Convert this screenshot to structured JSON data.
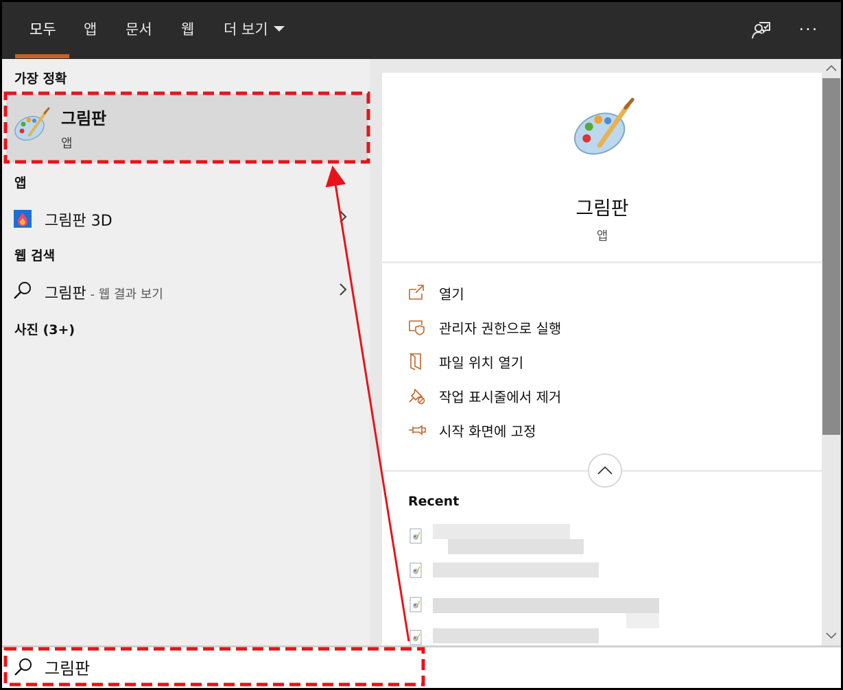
{
  "topbar": {
    "tabs": [
      {
        "label": "모두",
        "active": true
      },
      {
        "label": "앱"
      },
      {
        "label": "문서"
      },
      {
        "label": "웹"
      },
      {
        "label": "더 보기"
      }
    ],
    "feedback_icon": "feedback-icon",
    "options_label": "···"
  },
  "left": {
    "best_match_heading": "가장 정확",
    "best_match": {
      "title": "그림판",
      "subtitle": "앱",
      "icon": "paint-palette-icon"
    },
    "apps_heading": "앱",
    "apps": [
      {
        "label": "그림판 3D",
        "icon": "paint3d-icon"
      }
    ],
    "web_heading": "웹 검색",
    "web": [
      {
        "label": "그림판",
        "suffix": " - 웹 결과 보기",
        "icon": "search-icon"
      }
    ],
    "photos_heading": "사진 (3+)"
  },
  "right": {
    "app_name": "그림판",
    "app_type": "앱",
    "actions": [
      {
        "label": "열기",
        "icon": "open-icon"
      },
      {
        "label": "관리자 권한으로 실행",
        "icon": "shield-icon"
      },
      {
        "label": "파일 위치 열기",
        "icon": "file-location-icon"
      },
      {
        "label": "작업 표시줄에서 제거",
        "icon": "unpin-icon"
      },
      {
        "label": "시작 화면에 고정",
        "icon": "pin-icon"
      }
    ],
    "recent_heading": "Recent"
  },
  "search": {
    "value": "그림판"
  },
  "colors": {
    "accent": "#c0652c",
    "annotation": "#e8131a",
    "topbar": "#2b2b2b"
  }
}
